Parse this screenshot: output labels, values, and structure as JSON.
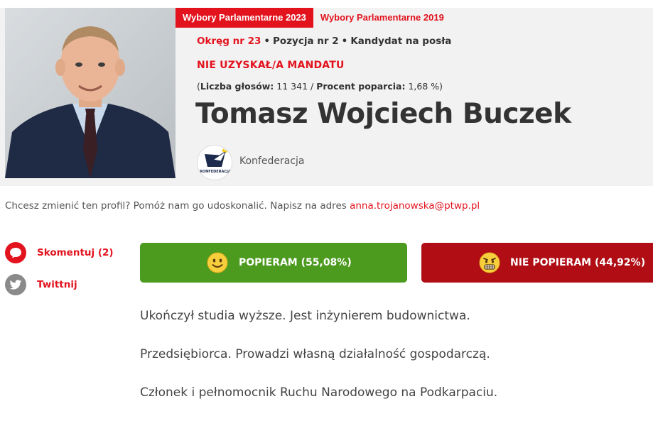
{
  "tabs": [
    {
      "label": "Wybory Parlamentarne 2023",
      "active": true
    },
    {
      "label": "Wybory Parlamentarne 2019",
      "active": false
    }
  ],
  "meta": {
    "district": "Okręg nr 23",
    "position": "Pozycja nr 2",
    "candidacy": "Kandydat na posła"
  },
  "mandate_status": "NIE UZYSKAŁ/A MANDATU",
  "stats": {
    "votes_label": "Liczba głosów:",
    "votes_value": "11 341",
    "percent_label": "Procent poparcia:",
    "percent_value": "1,68 %"
  },
  "candidate": {
    "name": "Tomasz Wojciech Buczek",
    "party": "Konfederacja",
    "party_logo_text": "KONFEDERACJA"
  },
  "edit_note": {
    "text": "Chcesz zmienić ten profil? Pomóż nam go udoskonalić. Napisz na adres ",
    "email": "anna.trojanowska@ptwp.pl"
  },
  "actions": {
    "comment_label": "Skomentuj (2)",
    "tweet_label": "Twittnij"
  },
  "votes": {
    "support_label": "POPIERAM (55,08%)",
    "oppose_label": "NIE POPIERAM (44,92%)",
    "support_percent": 55.08,
    "oppose_percent": 44.92
  },
  "bio": [
    "Ukończył studia wyższe. Jest inżynierem budownictwa.",
    "Przedsiębiorca. Prowadzi własną działalność gospodarczą.",
    "Członek i pełnomocnik Ruchu Narodowego na Podkarpaciu."
  ],
  "colors": {
    "accent_red": "#e3131e",
    "support_green": "#4c9a1e",
    "oppose_red": "#b00d14",
    "card_bg": "#f2f2f2"
  }
}
